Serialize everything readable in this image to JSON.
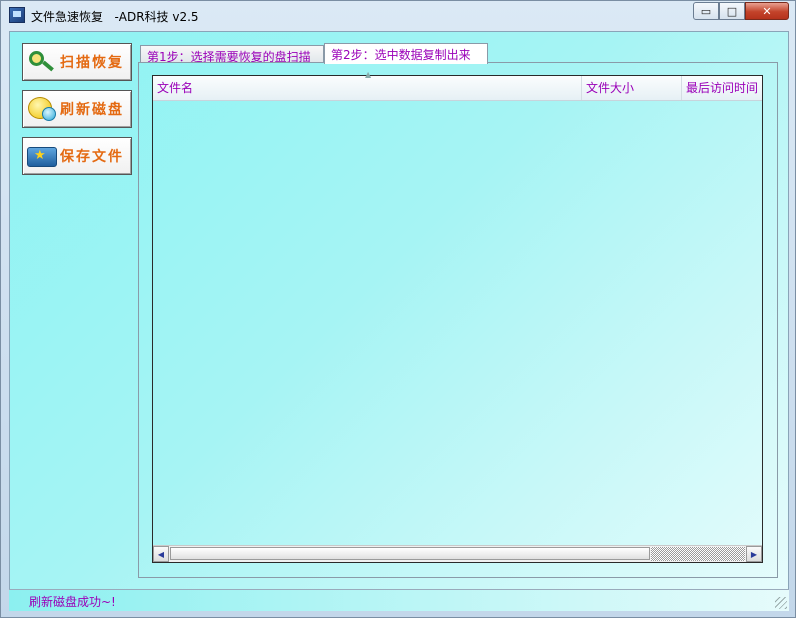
{
  "window": {
    "title": "文件急速恢复   -ADR科技 v2.5",
    "controls": {
      "minimize": "▭",
      "maximize": "□",
      "close": "✕"
    }
  },
  "sidebar": {
    "buttons": [
      {
        "label": "扫描恢复",
        "icon": "magnifier-icon"
      },
      {
        "label": "刷新磁盘",
        "icon": "refresh-disk-icon"
      },
      {
        "label": "保存文件",
        "icon": "save-folder-icon"
      }
    ]
  },
  "tabs": [
    {
      "label": "第1步：选择需要恢复的盘扫描",
      "active": false
    },
    {
      "label": "第2步：选中数据复制出来",
      "active": true
    }
  ],
  "file_list": {
    "columns": [
      "文件名",
      "文件大小",
      "最后访问时间"
    ],
    "rows": []
  },
  "status": {
    "text": "刷新磁盘成功~!"
  },
  "colors": {
    "accent_text": "#9a00b8",
    "button_label": "#e46a12",
    "client_bg_start": "#8df3f3",
    "client_bg_end": "#e8fcfc"
  }
}
